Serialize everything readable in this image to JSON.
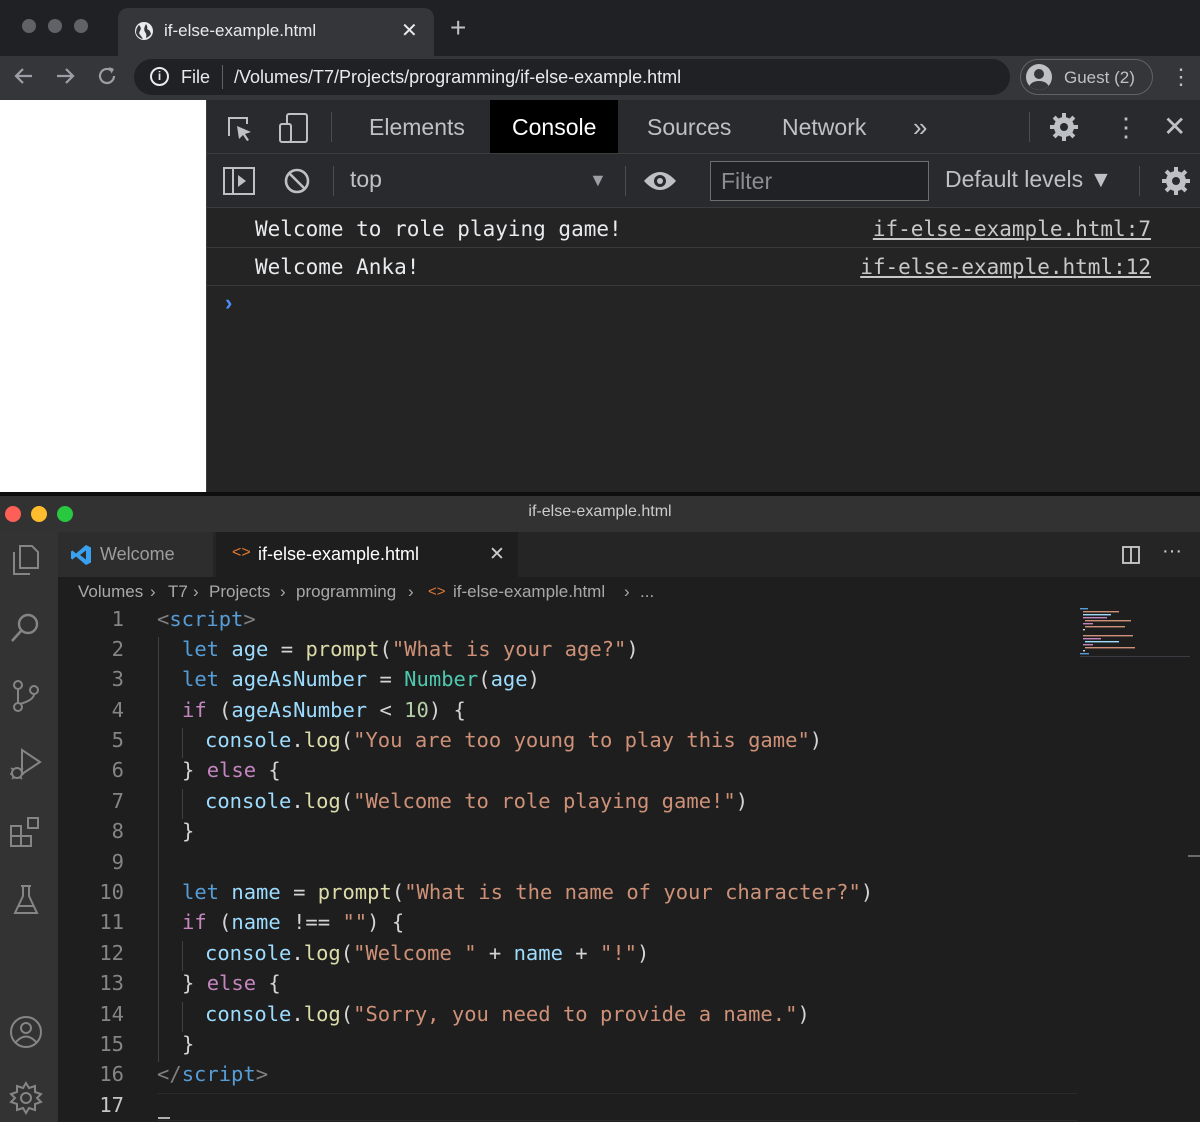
{
  "browser": {
    "tab_title": "if-else-example.html",
    "new_tab": "+",
    "tab_close": "✕",
    "omnibox_scheme": "File",
    "omnibox_url": "/Volumes/T7/Projects/programming/if-else-example.html",
    "profile_label": "Guest (2)"
  },
  "devtools": {
    "tabs": [
      "Elements",
      "Console",
      "Sources",
      "Network"
    ],
    "more_tabs": "»",
    "context": "top",
    "filter_placeholder": "Filter",
    "levels": "Default levels ▼",
    "messages": [
      {
        "text": "Welcome to role playing game!",
        "source": "if-else-example.html:7"
      },
      {
        "text": "Welcome Anka!",
        "source": "if-else-example.html:12"
      }
    ],
    "prompt": "›"
  },
  "vscode": {
    "window_title": "if-else-example.html",
    "tabs": [
      "Welcome",
      "if-else-example.html"
    ],
    "breadcrumb": [
      "Volumes",
      "T7",
      "Projects",
      "programming",
      "if-else-example.html",
      "..."
    ],
    "line_numbers": [
      "1",
      "2",
      "3",
      "4",
      "5",
      "6",
      "7",
      "8",
      "9",
      "10",
      "11",
      "12",
      "13",
      "14",
      "15",
      "16",
      "17"
    ],
    "code": {
      "l1_tag": "script",
      "let": "let",
      "if": "if",
      "else": "else",
      "console": "console",
      "log": "log",
      "l2_var": "age",
      "l2_fn": "prompt",
      "l2_str": "\"What is your age?\"",
      "l3_var": "ageAsNumber",
      "l3_type": "Number",
      "l3_arg": "age",
      "l4_var": "ageAsNumber",
      "l4_op": " < ",
      "l4_num": "10",
      "l5_str": "\"You are too young to play this game\"",
      "l7_str": "\"Welcome to role playing game!\"",
      "l10_var": "name",
      "l10_fn": "prompt",
      "l10_str": "\"What is the name of your character?\"",
      "l11_var": "name",
      "l11_op": " !== ",
      "l11_str": "\"\"",
      "l12_str1": "\"Welcome \"",
      "l12_var": "name",
      "l12_str2": "\"!\"",
      "l14_str": "\"Sorry, you need to provide a name.\"",
      "l16_tag": "script"
    }
  },
  "colors": {
    "keyword": "#569cd6",
    "control": "#c586c0",
    "variable": "#9cdcfe",
    "function": "#dcdcaa",
    "string": "#ce9178",
    "number": "#b5cea8",
    "type": "#4ec9b0"
  }
}
